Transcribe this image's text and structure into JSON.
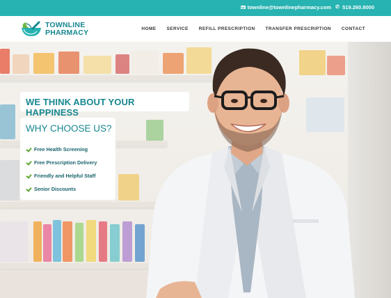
{
  "topbar": {
    "email": "townline@townlinepharmacy.com",
    "phone": "519.260.8000",
    "email_icon": "envelope-icon",
    "phone_icon": "phone-icon"
  },
  "logo": {
    "line1": "TOWNLINE",
    "line2": "PHARMACY",
    "icon": "mortar-pestle-icon"
  },
  "nav": {
    "items": [
      {
        "label": "HOME"
      },
      {
        "label": "SERVICE"
      },
      {
        "label": "REFILL PRESCRIPTION"
      },
      {
        "label": "TRANSFER PRESCRIPTION"
      },
      {
        "label": "CONTACT"
      }
    ]
  },
  "hero": {
    "tagline": "WE THINK ABOUT YOUR HAPPINESS",
    "why_title": "WHY CHOOSE US?",
    "reasons": [
      {
        "label": "Free Health Screening"
      },
      {
        "label": "Free Prescription Delivery"
      },
      {
        "label": "Friendly and Helpful Staff"
      },
      {
        "label": "Senior Discounts"
      }
    ]
  },
  "colors": {
    "brand_teal": "#27b3b1",
    "brand_dark_teal": "#16878f",
    "check_green": "#5fa532"
  }
}
